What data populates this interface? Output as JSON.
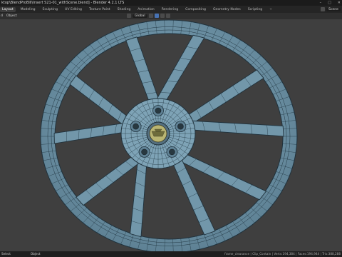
{
  "window": {
    "title": "ktop\\BlendProBill\\Insert S21-01_withScene.blend] - Blender 4.2.1 LTS",
    "controls": [
      "–",
      "□",
      "✕"
    ]
  },
  "workspace_tabs": [
    "Layout",
    "Modeling",
    "Sculpting",
    "UV Editing",
    "Texture Paint",
    "Shading",
    "Animation",
    "Rendering",
    "Compositing",
    "Geometry Nodes",
    "Scripting"
  ],
  "active_tab": "Layout",
  "add_tab": "+",
  "scene_field": "Scene",
  "toolbar": {
    "left_items": [
      "d",
      "Object"
    ],
    "orientation_field": "Global"
  },
  "status": {
    "left_items": [
      "Select",
      "Object"
    ],
    "stats": "frame_clearance | Clip_Contain | Verts:194,384 | Faces:194,944 | Tris:388,288"
  },
  "colors": {
    "background": "#3f3f3f",
    "mesh_fill": "#6f93a6",
    "wire": "#223743",
    "cap_accent": "#b9b572"
  },
  "icons": [
    "minimize-icon",
    "maximize-icon",
    "close-icon",
    "scene-icon",
    "cursor-icon",
    "view-icon",
    "snap-icon",
    "proportional-icon",
    "overlay-icon"
  ]
}
